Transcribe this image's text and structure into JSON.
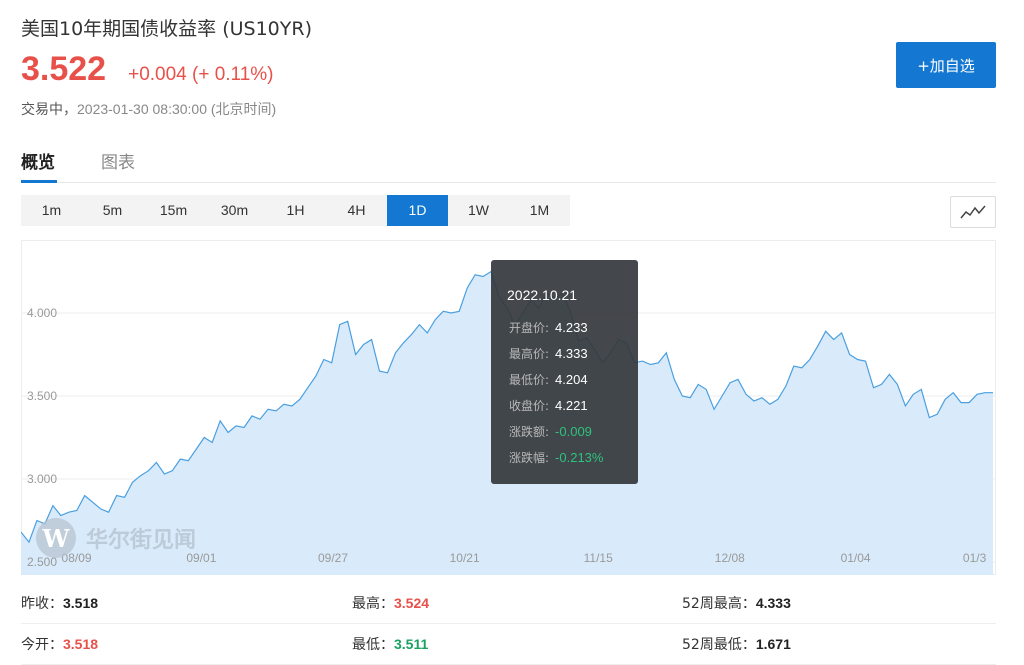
{
  "header": {
    "title": "美国10年期国债收益率 (US10YR)",
    "price": "3.522",
    "change": "+0.004 (+ 0.11%)",
    "status_label": "交易中，",
    "status_time": "2023-01-30 08:30:00 (北京时间)",
    "add_button": "+加自选"
  },
  "tabs": [
    {
      "label": "概览",
      "active": true
    },
    {
      "label": "图表",
      "active": false
    }
  ],
  "periods": [
    {
      "label": "1m",
      "active": false
    },
    {
      "label": "5m",
      "active": false
    },
    {
      "label": "15m",
      "active": false
    },
    {
      "label": "30m",
      "active": false
    },
    {
      "label": "1H",
      "active": false
    },
    {
      "label": "4H",
      "active": false
    },
    {
      "label": "1D",
      "active": true
    },
    {
      "label": "1W",
      "active": false
    },
    {
      "label": "1M",
      "active": false
    }
  ],
  "chart_type_icon": "line-chart-icon",
  "colors": {
    "accent": "#1478d2",
    "up": "#e8514a",
    "down": "#1aa260",
    "line": "#4a9fe0",
    "fill": "#d9ebfb"
  },
  "chart_data": {
    "type": "area",
    "y_ticks": [
      "2.500",
      "3.000",
      "3.500",
      "4.000"
    ],
    "x_ticks": [
      "08/09",
      "09/01",
      "09/27",
      "10/21",
      "11/15",
      "12/08",
      "01/04",
      "01/3"
    ],
    "ylim": [
      2.5,
      4.3
    ],
    "grid": true,
    "values": [
      2.68,
      2.62,
      2.75,
      2.73,
      2.84,
      2.78,
      2.8,
      2.81,
      2.9,
      2.86,
      2.82,
      2.8,
      2.9,
      2.89,
      2.98,
      3.02,
      3.05,
      3.1,
      3.03,
      3.05,
      3.12,
      3.11,
      3.18,
      3.25,
      3.22,
      3.35,
      3.28,
      3.32,
      3.31,
      3.38,
      3.36,
      3.42,
      3.41,
      3.45,
      3.44,
      3.48,
      3.55,
      3.62,
      3.72,
      3.7,
      3.93,
      3.95,
      3.75,
      3.81,
      3.84,
      3.65,
      3.64,
      3.76,
      3.82,
      3.87,
      3.93,
      3.88,
      3.96,
      4.01,
      4.0,
      4.01,
      4.15,
      4.23,
      4.22,
      4.25,
      4.1,
      4.03,
      3.93,
      4.0,
      4.08,
      4.03,
      4.12,
      4.09,
      4.12,
      4.0,
      3.83,
      3.85,
      3.78,
      3.7,
      3.76,
      3.84,
      3.82,
      3.7,
      3.71,
      3.69,
      3.7,
      3.76,
      3.6,
      3.5,
      3.49,
      3.57,
      3.54,
      3.42,
      3.5,
      3.58,
      3.6,
      3.51,
      3.47,
      3.49,
      3.45,
      3.48,
      3.56,
      3.68,
      3.67,
      3.72,
      3.8,
      3.89,
      3.84,
      3.88,
      3.75,
      3.72,
      3.71,
      3.55,
      3.57,
      3.63,
      3.57,
      3.44,
      3.51,
      3.54,
      3.37,
      3.39,
      3.48,
      3.52,
      3.46,
      3.46,
      3.51,
      3.52,
      3.52
    ],
    "tooltip": {
      "date": "2022.10.21",
      "rows": [
        {
          "label": "开盘价:",
          "value": "4.233",
          "color": "white"
        },
        {
          "label": "最高价:",
          "value": "4.333",
          "color": "white"
        },
        {
          "label": "最低价:",
          "value": "4.204",
          "color": "white"
        },
        {
          "label": "收盘价:",
          "value": "4.221",
          "color": "white"
        },
        {
          "label": "涨跌额:",
          "value": "-0.009",
          "color": "green"
        },
        {
          "label": "涨跌幅:",
          "value": "-0.213%",
          "color": "green"
        }
      ]
    }
  },
  "watermark": {
    "text": "华尔街见闻",
    "logo_icon": "wallstreetcn-logo-icon"
  },
  "stats": {
    "prev_close": {
      "label": "昨收：",
      "value": "3.518"
    },
    "high": {
      "label": "最高：",
      "value": "3.524"
    },
    "high_52w": {
      "label": "52周最高：",
      "value": "4.333"
    },
    "open": {
      "label": "今开：",
      "value": "3.518"
    },
    "low": {
      "label": "最低：",
      "value": "3.511"
    },
    "low_52w": {
      "label": "52周最低：",
      "value": "1.671"
    }
  }
}
